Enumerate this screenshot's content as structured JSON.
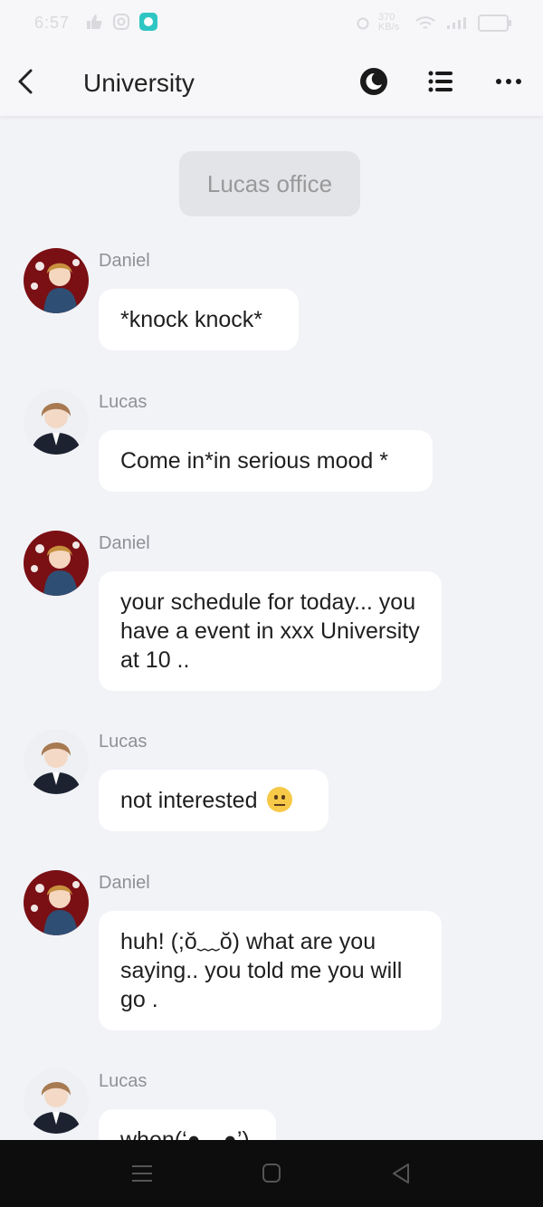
{
  "status_bar": {
    "time": "6:57",
    "network": "370 KB/s"
  },
  "header": {
    "title": "University"
  },
  "scene": {
    "label": "Lucas office"
  },
  "messages": [
    {
      "sender": "Daniel",
      "text": "*knock knock*",
      "avatar": "daniel-avatar"
    },
    {
      "sender": "Lucas",
      "text": "Come in*in serious mood *",
      "avatar": "lucas-avatar"
    },
    {
      "sender": "Daniel",
      "text": "your schedule for today... you have a event in xxx University at 10 ..",
      "avatar": "daniel-avatar"
    },
    {
      "sender": "Lucas",
      "text": "not interested",
      "emoji": "neutral-face-emoji",
      "avatar": "lucas-avatar"
    },
    {
      "sender": "Daniel",
      "text": "huh! (;ŏ﹏ŏ) what are you saying.. you told me you will go .",
      "avatar": "daniel-avatar"
    },
    {
      "sender": "Lucas",
      "text": "when(‘◓﹏◓’)",
      "avatar": "lucas-avatar"
    }
  ],
  "icons": {
    "back": "chevron-left-icon",
    "theme": "moon-icon",
    "list": "list-icon",
    "more": "more-dots-icon",
    "nav_menu": "menu-icon",
    "nav_home": "home-square-icon",
    "nav_back": "triangle-back-icon"
  },
  "colors": {
    "background": "#f2f3f7",
    "bubble": "#ffffff",
    "chip": "#e3e4e8",
    "sender": "#8f9096"
  }
}
